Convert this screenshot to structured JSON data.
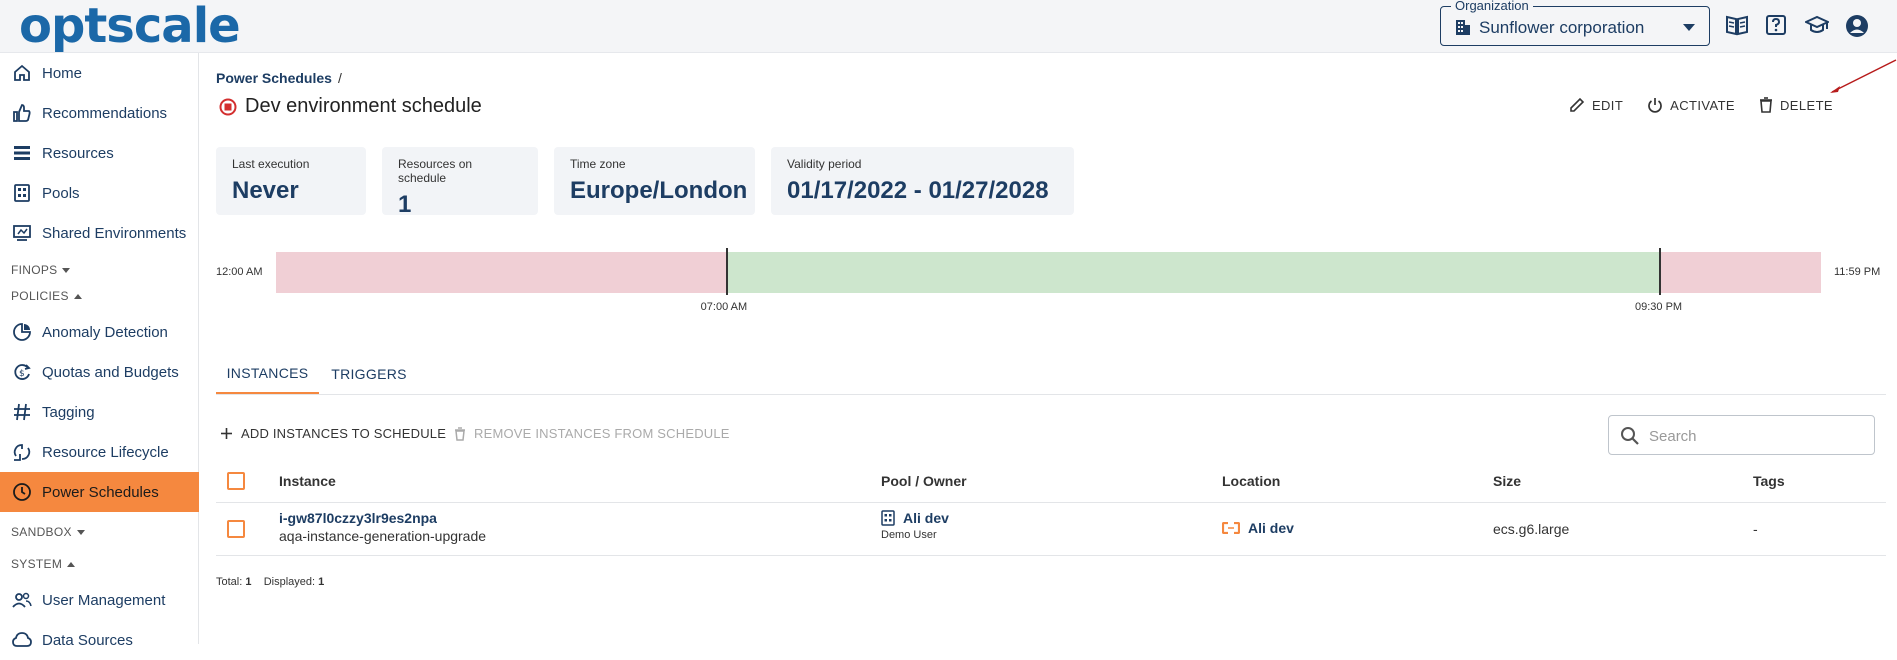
{
  "header": {
    "logo": "optscale",
    "organization_label": "Organization",
    "organization_value": "Sunflower corporation",
    "icons": [
      "book-icon",
      "help-icon",
      "graduation-cap-icon",
      "account-icon"
    ]
  },
  "sidebar": {
    "items": [
      {
        "label": "Home",
        "icon": "home-icon"
      },
      {
        "label": "Recommendations",
        "icon": "thumbs-up-icon"
      },
      {
        "label": "Resources",
        "icon": "list-icon"
      },
      {
        "label": "Pools",
        "icon": "pools-icon"
      },
      {
        "label": "Shared Environments",
        "icon": "monitor-icon"
      }
    ],
    "group_finops": "FINOPS",
    "group_policies": "POLICIES",
    "policies_items": [
      {
        "label": "Anomaly Detection",
        "icon": "anomaly-icon"
      },
      {
        "label": "Quotas and Budgets",
        "icon": "quota-icon"
      },
      {
        "label": "Tagging",
        "icon": "hashtag-icon"
      },
      {
        "label": "Resource Lifecycle",
        "icon": "lifecycle-icon"
      },
      {
        "label": "Power Schedules",
        "icon": "clock-icon"
      }
    ],
    "group_sandbox": "SANDBOX",
    "group_system": "SYSTEM",
    "system_items": [
      {
        "label": "User Management",
        "icon": "users-icon"
      },
      {
        "label": "Data Sources",
        "icon": "cloud-icon"
      }
    ]
  },
  "breadcrumb": {
    "parent": "Power Schedules",
    "separator": "/"
  },
  "page": {
    "title": "Dev environment schedule",
    "status_icon": "stop-circle-icon",
    "actions": {
      "edit": "EDIT",
      "activate": "ACTIVATE",
      "delete": "DELETE"
    }
  },
  "cards": [
    {
      "label": "Last execution",
      "value": "Never"
    },
    {
      "label": "Resources on schedule",
      "value": "1"
    },
    {
      "label": "Time zone",
      "value": "Europe/London"
    },
    {
      "label": "Validity period",
      "value": "01/17/2022 - 01/27/2028"
    }
  ],
  "timeline": {
    "start_label": "12:00 AM",
    "end_label": "11:59 PM",
    "on_label": "07:00 AM",
    "off_label": "09:30 PM",
    "on_fraction": 0.2917,
    "off_fraction": 0.8958,
    "off_color": "#f0cfd5",
    "on_color": "#cde6cd"
  },
  "tabs": [
    {
      "label": "INSTANCES",
      "active": true
    },
    {
      "label": "TRIGGERS",
      "active": false
    }
  ],
  "toolbar": {
    "add": "ADD INSTANCES TO SCHEDULE",
    "remove": "REMOVE INSTANCES FROM SCHEDULE",
    "search_placeholder": "Search"
  },
  "table": {
    "columns": [
      "Instance",
      "Pool / Owner",
      "Location",
      "Size",
      "Tags"
    ],
    "rows": [
      {
        "instance_id": "i-gw87l0czzy3lr9es2npa",
        "instance_name": "aqa-instance-generation-upgrade",
        "pool": "Ali dev",
        "owner": "Demo User",
        "location": "Ali dev",
        "size": "ecs.g6.large",
        "tags": "-"
      }
    ]
  },
  "footer": {
    "total_label": "Total:",
    "total_value": "1",
    "displayed_label": "Displayed:",
    "displayed_value": "1"
  },
  "colors": {
    "accent": "#f5883f",
    "primary": "#1d3d63",
    "logo": "#1b68a8",
    "stop_red": "#d32f2f",
    "arrow": "#b71c1c"
  }
}
